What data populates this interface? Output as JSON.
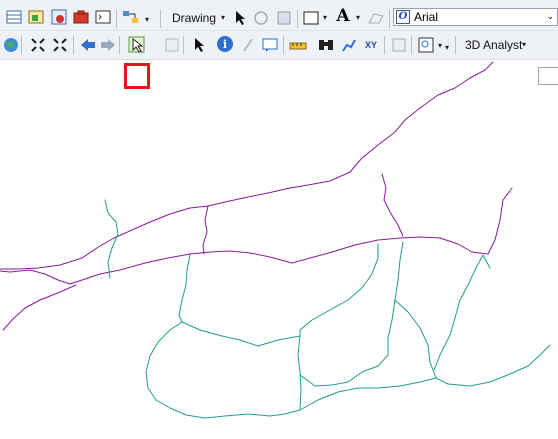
{
  "toolbar_top": {
    "drawing_label": "Drawing",
    "font_value": "Arial",
    "icons": [
      "layout-icon",
      "add-data-icon",
      "catalog-icon",
      "toolbox-icon",
      "python-icon",
      "model-icon"
    ]
  },
  "toolbar_bottom": {
    "analyst_label": "3D Analyst",
    "highlighted_tool": "select-features-icon"
  },
  "colors": {
    "road": "#8a1a9c",
    "stream": "#1f9e89",
    "highlight": "#e8141c",
    "toolbar_bg": "#eef1f6"
  }
}
